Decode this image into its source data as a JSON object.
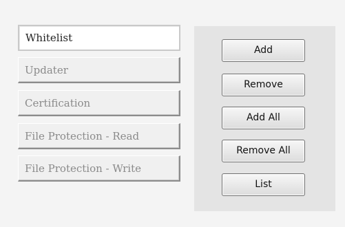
{
  "nav": {
    "items": [
      {
        "label": "Whitelist",
        "selected": true
      },
      {
        "label": "Updater",
        "selected": false
      },
      {
        "label": "Certification",
        "selected": false
      },
      {
        "label": "File Protection - Read",
        "selected": false
      },
      {
        "label": "File Protection - Write",
        "selected": false
      }
    ]
  },
  "actions": {
    "add": "Add",
    "remove": "Remove",
    "add_all": "Add All",
    "remove_all": "Remove All",
    "list": "List"
  }
}
